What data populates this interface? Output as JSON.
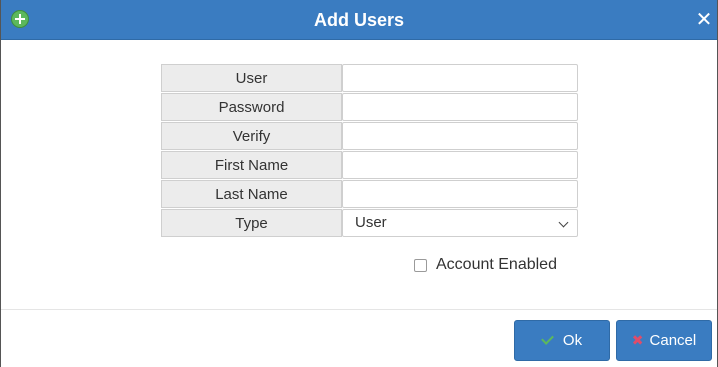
{
  "dialog": {
    "title": "Add Users",
    "close_symbol": "✕"
  },
  "form": {
    "fields": [
      {
        "label": "User",
        "value": ""
      },
      {
        "label": "Password",
        "value": ""
      },
      {
        "label": "Verify",
        "value": ""
      },
      {
        "label": "First Name",
        "value": ""
      },
      {
        "label": "Last Name",
        "value": ""
      }
    ],
    "type": {
      "label": "Type",
      "selected": "User"
    },
    "account_enabled": {
      "label": "Account Enabled",
      "checked": false
    }
  },
  "buttons": {
    "ok_label": "Ok",
    "cancel_label": "Cancel",
    "cancel_symbol": "✖"
  },
  "colors": {
    "titlebar": "#3a7cc1",
    "add_icon": "#5cb85c",
    "cancel_icon": "#e04c6a"
  },
  "icons": [
    "add-circle-icon",
    "close-icon",
    "chevron-down-icon",
    "check-icon",
    "x-icon"
  ]
}
